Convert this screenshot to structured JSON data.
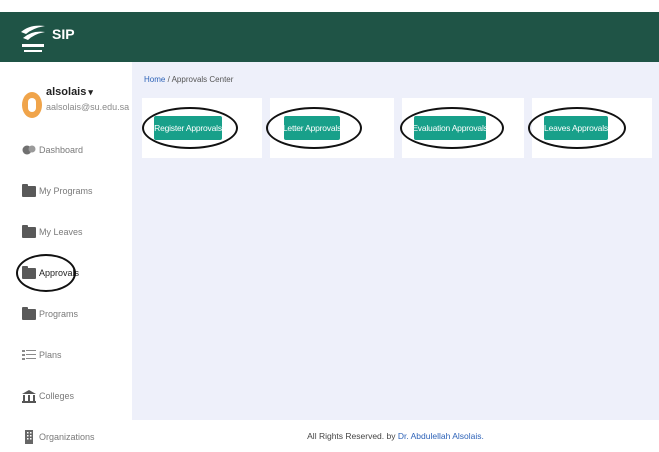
{
  "header": {
    "app_name": "SIP",
    "logo_icon": "university-logo-icon",
    "brand_color": "#1f5446"
  },
  "user": {
    "name": "alsolais",
    "email": "aalsolais@su.edu.sa",
    "chevron": "▾"
  },
  "sidebar": {
    "items": [
      {
        "label": "Dashboard",
        "icon": "dashboard-icon"
      },
      {
        "label": "My Programs",
        "icon": "folder-icon"
      },
      {
        "label": "My Leaves",
        "icon": "folder-icon"
      },
      {
        "label": "Approvals",
        "icon": "folder-icon",
        "active": true
      },
      {
        "label": "Programs",
        "icon": "folder-icon"
      },
      {
        "label": "Plans",
        "icon": "list-icon"
      },
      {
        "label": "Colleges",
        "icon": "building-icon"
      },
      {
        "label": "Organizations",
        "icon": "organization-icon"
      }
    ]
  },
  "breadcrumb": {
    "home": "Home",
    "separator": "/",
    "current": "Approvals Center"
  },
  "approvals": {
    "buttons": [
      {
        "label": "Register Approvals"
      },
      {
        "label": "Letter Approvals"
      },
      {
        "label": "Evaluation Approvals"
      },
      {
        "label": "Leaves Approvals"
      }
    ],
    "button_color": "#18a08a"
  },
  "footer": {
    "text": "All Rights Reserved. by",
    "author": "Dr. Abdulellah Alsolais."
  }
}
